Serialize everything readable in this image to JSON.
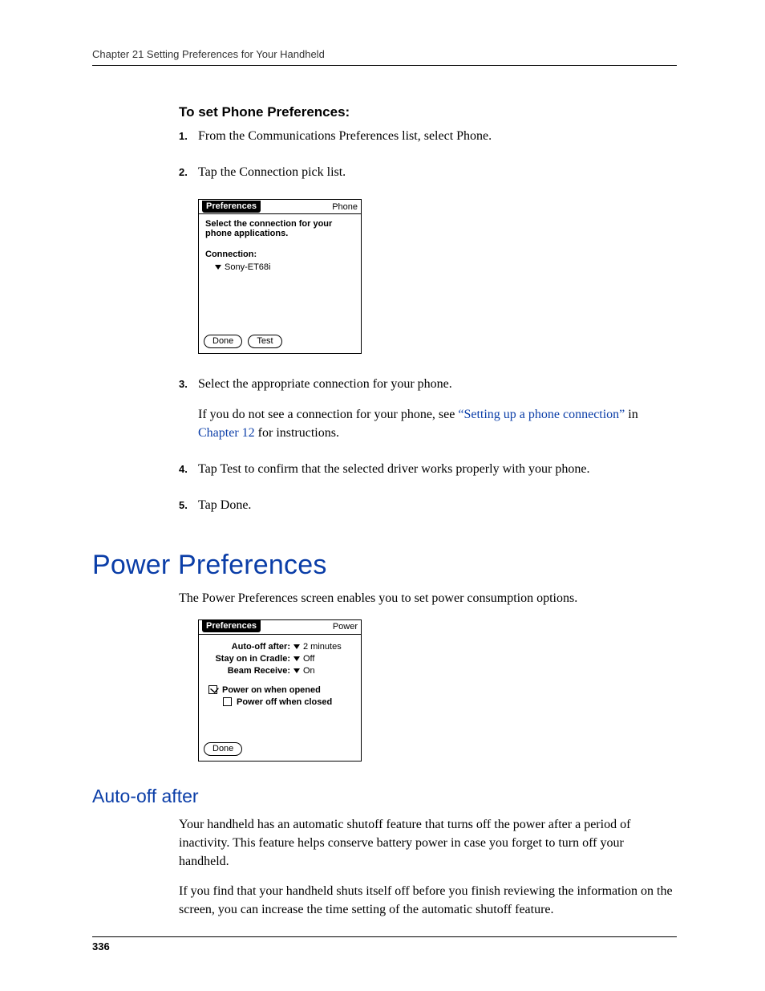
{
  "header": {
    "running": "Chapter 21    Setting Preferences for Your Handheld"
  },
  "proc1": {
    "heading": "To set Phone Preferences:",
    "steps": {
      "s1": {
        "num": "1.",
        "text": "From the Communications Preferences list, select Phone."
      },
      "s2": {
        "num": "2.",
        "text": "Tap the Connection pick list."
      },
      "s3": {
        "num": "3.",
        "text": "Select the appropriate connection for your phone.",
        "note_pre": "If you do not see a connection for your phone, see ",
        "link1": "“Setting up a phone connection”",
        "mid": " in ",
        "link2": "Chapter 12",
        "post": " for instructions."
      },
      "s4": {
        "num": "4.",
        "text": "Tap Test to confirm that the selected driver works properly with your phone."
      },
      "s5": {
        "num": "5.",
        "text": "Tap Done."
      }
    }
  },
  "shot1": {
    "title": "Preferences",
    "category": "Phone",
    "caption": "Select the connection for your phone applications.",
    "conn_label": "Connection:",
    "conn_value": "Sony-ET68i",
    "btn_done": "Done",
    "btn_test": "Test"
  },
  "section": {
    "h1": "Power Preferences",
    "intro": "The Power Preferences screen enables you to set power consumption options."
  },
  "shot2": {
    "title": "Preferences",
    "category": "Power",
    "rows": {
      "r1": {
        "label": "Auto-off after:",
        "value": "2 minutes"
      },
      "r2": {
        "label": "Stay on in Cradle:",
        "value": "Off"
      },
      "r3": {
        "label": "Beam Receive:",
        "value": "On"
      }
    },
    "cb1": "Power on when opened",
    "cb2": "Power off when closed",
    "btn_done": "Done"
  },
  "subsection": {
    "h2": "Auto-off after",
    "p1": "Your handheld has an automatic shutoff feature that turns off the power after a period of inactivity. This feature helps conserve battery power in case you forget to turn off your handheld.",
    "p2": "If you find that your handheld shuts itself off before you finish reviewing the information on the screen, you can increase the time setting of the automatic shutoff feature."
  },
  "page_number": "336"
}
